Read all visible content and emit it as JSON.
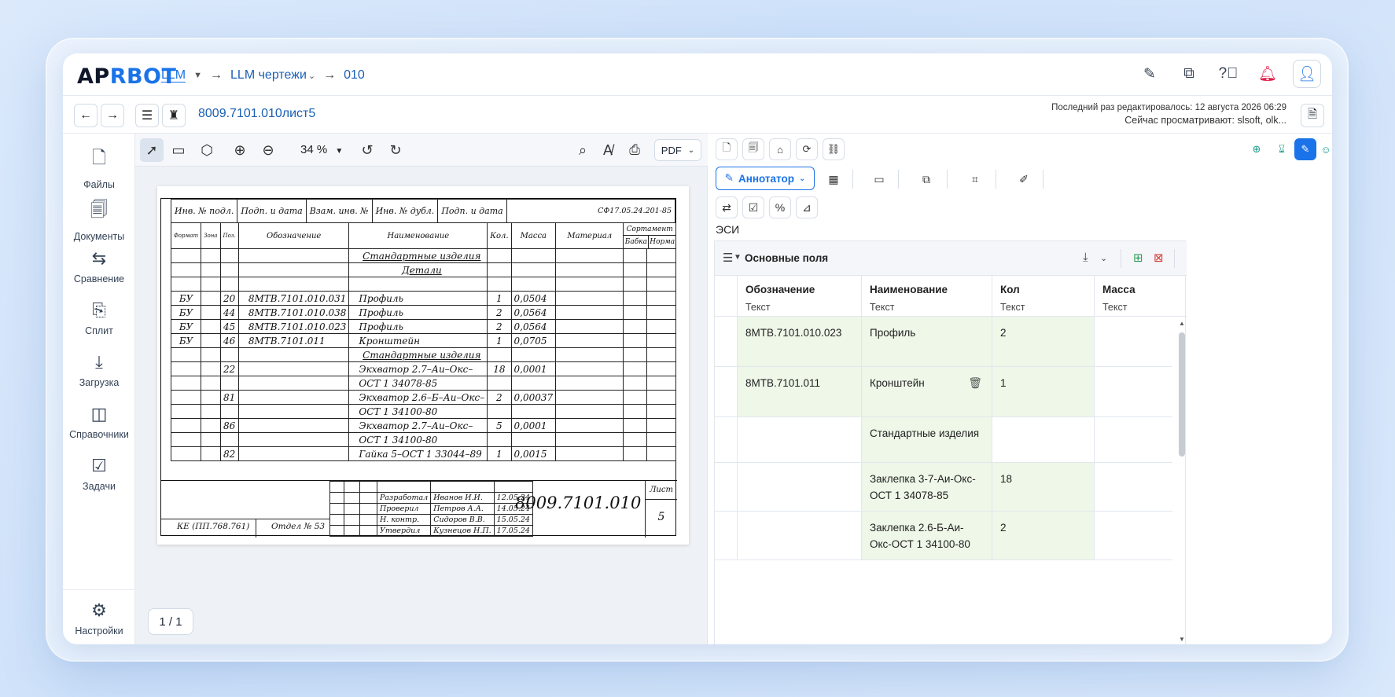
{
  "logo": {
    "part1": "AP",
    "part2": "RBOT"
  },
  "breadcrumbs": {
    "root": "LLM",
    "folder": "LLM чертежи",
    "item": "010"
  },
  "document": {
    "title": "8009.7101.010лист5",
    "last_edited": "Последний раз редактировалось: 12 августа 2026 06:29",
    "viewing": "Сейчас просматривают: slsoft, olk..."
  },
  "sidebar": {
    "items": [
      {
        "label": "Файлы",
        "icon": "file-icon"
      },
      {
        "label": "Документы",
        "icon": "documents-icon"
      },
      {
        "label": "Сравнение",
        "icon": "compare-icon"
      },
      {
        "label": "Сплит",
        "icon": "split-icon"
      },
      {
        "label": "Загрузка",
        "icon": "download-icon"
      },
      {
        "label": "Справочники",
        "icon": "book-icon"
      },
      {
        "label": "Задачи",
        "icon": "tasks-icon"
      },
      {
        "label": "Настройки",
        "icon": "gear-icon"
      }
    ]
  },
  "viewer": {
    "zoom": "34 %",
    "format": "PDF",
    "page": "1 / 1"
  },
  "drawing": {
    "header_cells": [
      "Инв. № подл.",
      "Подп. и дата",
      "Взам. инв. №",
      "Инв. № дубл.",
      "Подп. и дата"
    ],
    "doc_code": "СФ17.05.24.201-85",
    "columns": [
      "Формат",
      "Зона",
      "Поз.",
      "Обозначение",
      "Наименование",
      "Кол.",
      "Масса",
      "Материал",
      "Сортамент"
    ],
    "sortament_sub": [
      "Бабка",
      "Норма"
    ],
    "rows": [
      {
        "f": "",
        "z": "",
        "p": "",
        "code": "",
        "name": "Стандартные изделия",
        "qty": "",
        "mass": "",
        "section": true
      },
      {
        "f": "",
        "z": "",
        "p": "",
        "code": "",
        "name": "Детали",
        "qty": "",
        "mass": "",
        "section": true
      },
      {
        "f": "",
        "z": "",
        "p": "",
        "code": "",
        "name": "",
        "qty": "",
        "mass": ""
      },
      {
        "f": "БУ",
        "z": "",
        "p": "20",
        "code": "8МТВ.7101.010.031",
        "name": "Профиль",
        "qty": "1",
        "mass": "0,0504"
      },
      {
        "f": "БУ",
        "z": "",
        "p": "44",
        "code": "8МТВ.7101.010.038",
        "name": "Профиль",
        "qty": "2",
        "mass": "0,0564"
      },
      {
        "f": "БУ",
        "z": "",
        "p": "45",
        "code": "8МТВ.7101.010.023",
        "name": "Профиль",
        "qty": "2",
        "mass": "0,0564"
      },
      {
        "f": "БУ",
        "z": "",
        "p": "46",
        "code": "8МТВ.7101.011",
        "name": "Кронштейн",
        "qty": "1",
        "mass": "0,0705"
      },
      {
        "f": "",
        "z": "",
        "p": "",
        "code": "",
        "name": "Стандартные изделия",
        "qty": "",
        "mass": "",
        "section": true
      },
      {
        "f": "",
        "z": "",
        "p": "22",
        "code": "",
        "name": "Экхватор 2.7–Аи–Окс–",
        "qty": "18",
        "mass": "0,0001"
      },
      {
        "f": "",
        "z": "",
        "p": "",
        "code": "",
        "name": "ОСТ 1 34078-85",
        "qty": "",
        "mass": ""
      },
      {
        "f": "",
        "z": "",
        "p": "81",
        "code": "",
        "name": "Экхватор 2.6–Б–Аи–Окс–",
        "qty": "2",
        "mass": "0,00037"
      },
      {
        "f": "",
        "z": "",
        "p": "",
        "code": "",
        "name": "ОСТ 1 34100-80",
        "qty": "",
        "mass": ""
      },
      {
        "f": "",
        "z": "",
        "p": "86",
        "code": "",
        "name": "Экхватор 2.7–Аи–Окс–",
        "qty": "5",
        "mass": "0,0001"
      },
      {
        "f": "",
        "z": "",
        "p": "",
        "code": "",
        "name": "ОСТ 1 34100-80",
        "qty": "",
        "mass": ""
      },
      {
        "f": "",
        "z": "",
        "p": "82",
        "code": "",
        "name": "Гайка 5–ОСТ 1 33044–89",
        "qty": "1",
        "mass": "0,0015"
      }
    ],
    "signatures": [
      {
        "role": "Разработал",
        "name": "Иванов И.И.",
        "date": "12.05.24"
      },
      {
        "role": "Проверил",
        "name": "Петров А.А.",
        "date": "14.05.24"
      },
      {
        "role": "Н. контр.",
        "name": "Сидоров В.В.",
        "date": "15.05.24"
      },
      {
        "role": "Утвердил",
        "name": "Кузнецов Н.П.",
        "date": "17.05.24"
      }
    ],
    "stamp_code": "8009.7101.010",
    "sheet_label": "Лист",
    "sheet_number": "5",
    "ke": "КЕ (ПП.768.761)",
    "dept": "Отдел № 53"
  },
  "panel": {
    "annotator_label": "Аннотатор",
    "esi_label": "ЭСИ",
    "group_title": "Основные поля",
    "columns": [
      {
        "name": "Обозначение",
        "type": "Текст"
      },
      {
        "name": "Наименование",
        "type": "Текст"
      },
      {
        "name": "Кол",
        "type": "Текст"
      },
      {
        "name": "Масса",
        "type": "Текст"
      }
    ],
    "rows": [
      {
        "code": "8МТВ.7101.010.023",
        "name": "Профиль",
        "qty": "2",
        "mass": ""
      },
      {
        "code": "8МТВ.7101.011",
        "name": "Кронштейн",
        "qty": "1",
        "mass": ""
      },
      {
        "code": "",
        "name": "Стандартные изделия",
        "qty": "",
        "mass": ""
      },
      {
        "code": "",
        "name": "Заклепка 3-7-Аи-Окс-ОСТ 1 34078-85",
        "qty": "18",
        "mass": ""
      },
      {
        "code": "",
        "name": "Заклепка 2.6-Б-Аи-Окс-ОСТ 1 34100-80",
        "qty": "2",
        "mass": ""
      }
    ]
  },
  "colors": {
    "accent": "#1a73e8",
    "cell_green": "#eef7e8"
  }
}
